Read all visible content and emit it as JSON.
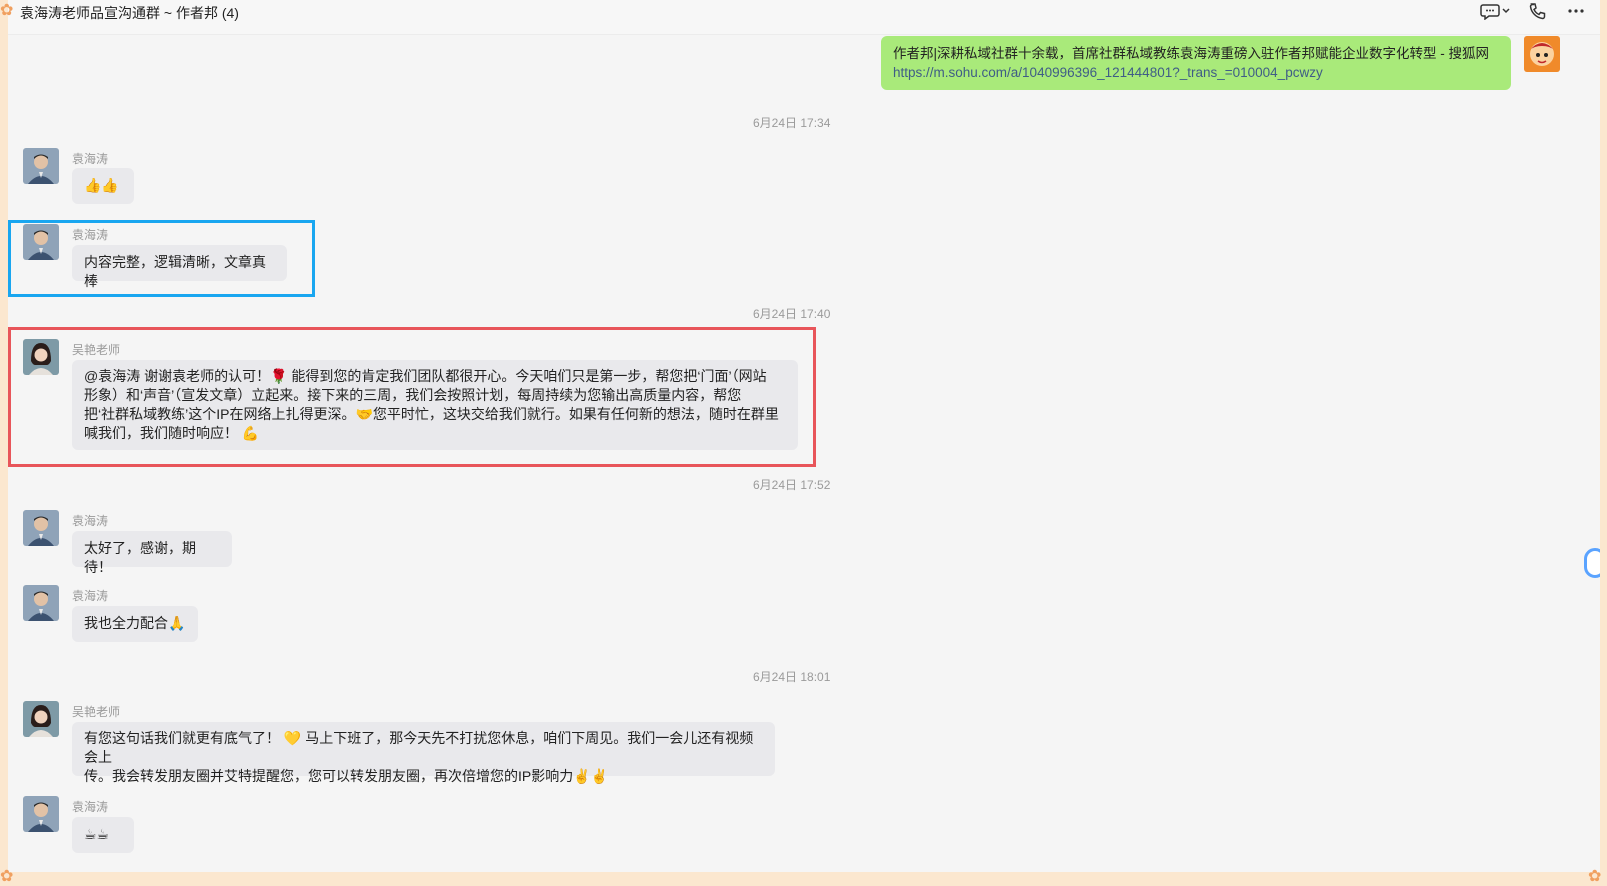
{
  "window": {
    "title": "袁海涛老师品宣沟通群 ~ 作者邦 (4)",
    "actions": [
      "chat-icon",
      "phone-icon",
      "more-icon"
    ]
  },
  "messages": [
    {
      "type": "mine",
      "text_line1": "作者邦|深耕私域社群十余载，首席社群私域教练袁海涛重磅入驻作者邦赋能企业数字化转型 - 搜狐网",
      "text_line2": "https://m.sohu.com/a/1040996396_121444801?_trans_=010004_pcwzy"
    },
    {
      "type": "time",
      "text": "6月24日 17:34"
    },
    {
      "type": "other",
      "sender": "袁海涛",
      "text": "👍👍"
    },
    {
      "type": "other",
      "sender": "袁海涛",
      "text": "内容完整，逻辑清晰，文章真棒"
    },
    {
      "type": "time",
      "text": "6月24日 17:40"
    },
    {
      "type": "other",
      "sender": "吴艳老师",
      "lines": [
        "@袁海涛  谢谢袁老师的认可！🌹 能得到您的肯定我们团队都很开心。今天咱们只是第一步，帮您把‘门面’（网站",
        "形象）和‘声音’（宣发文章）立起来。接下来的三周，我们会按照计划，每周持续为您输出高质量内容，帮您",
        "把‘社群私域教练’这个IP在网络上扎得更深。🤝您平时忙，这块交给我们就行。如果有任何新的想法，随时在群里",
        "喊我们，我们随时响应！ 💪"
      ]
    },
    {
      "type": "time",
      "text": "6月24日 17:52"
    },
    {
      "type": "other",
      "sender": "袁海涛",
      "text": "太好了，感谢，期待！"
    },
    {
      "type": "other",
      "sender": "袁海涛",
      "text": "我也全力配合🙏"
    },
    {
      "type": "time",
      "text": "6月24日 18:01"
    },
    {
      "type": "other",
      "sender": "吴艳老师",
      "lines": [
        "有您这句话我们就更有底气了！ 💛 马上下班了，那今天先不打扰您休息，咱们下周见。我们一会儿还有视频会上",
        "传。我会转发朋友圈并艾特提醒您，您可以转发朋友圈，再次倍增您的IP影响力✌️✌️"
      ]
    },
    {
      "type": "other",
      "sender": "袁海涛",
      "text": "☕☕"
    }
  ],
  "colors": {
    "highlight_blue": "#19a6f0",
    "highlight_red": "#e8555a",
    "mine_bubble": "#a9ea7a",
    "other_bubble": "#e9e9ec"
  }
}
